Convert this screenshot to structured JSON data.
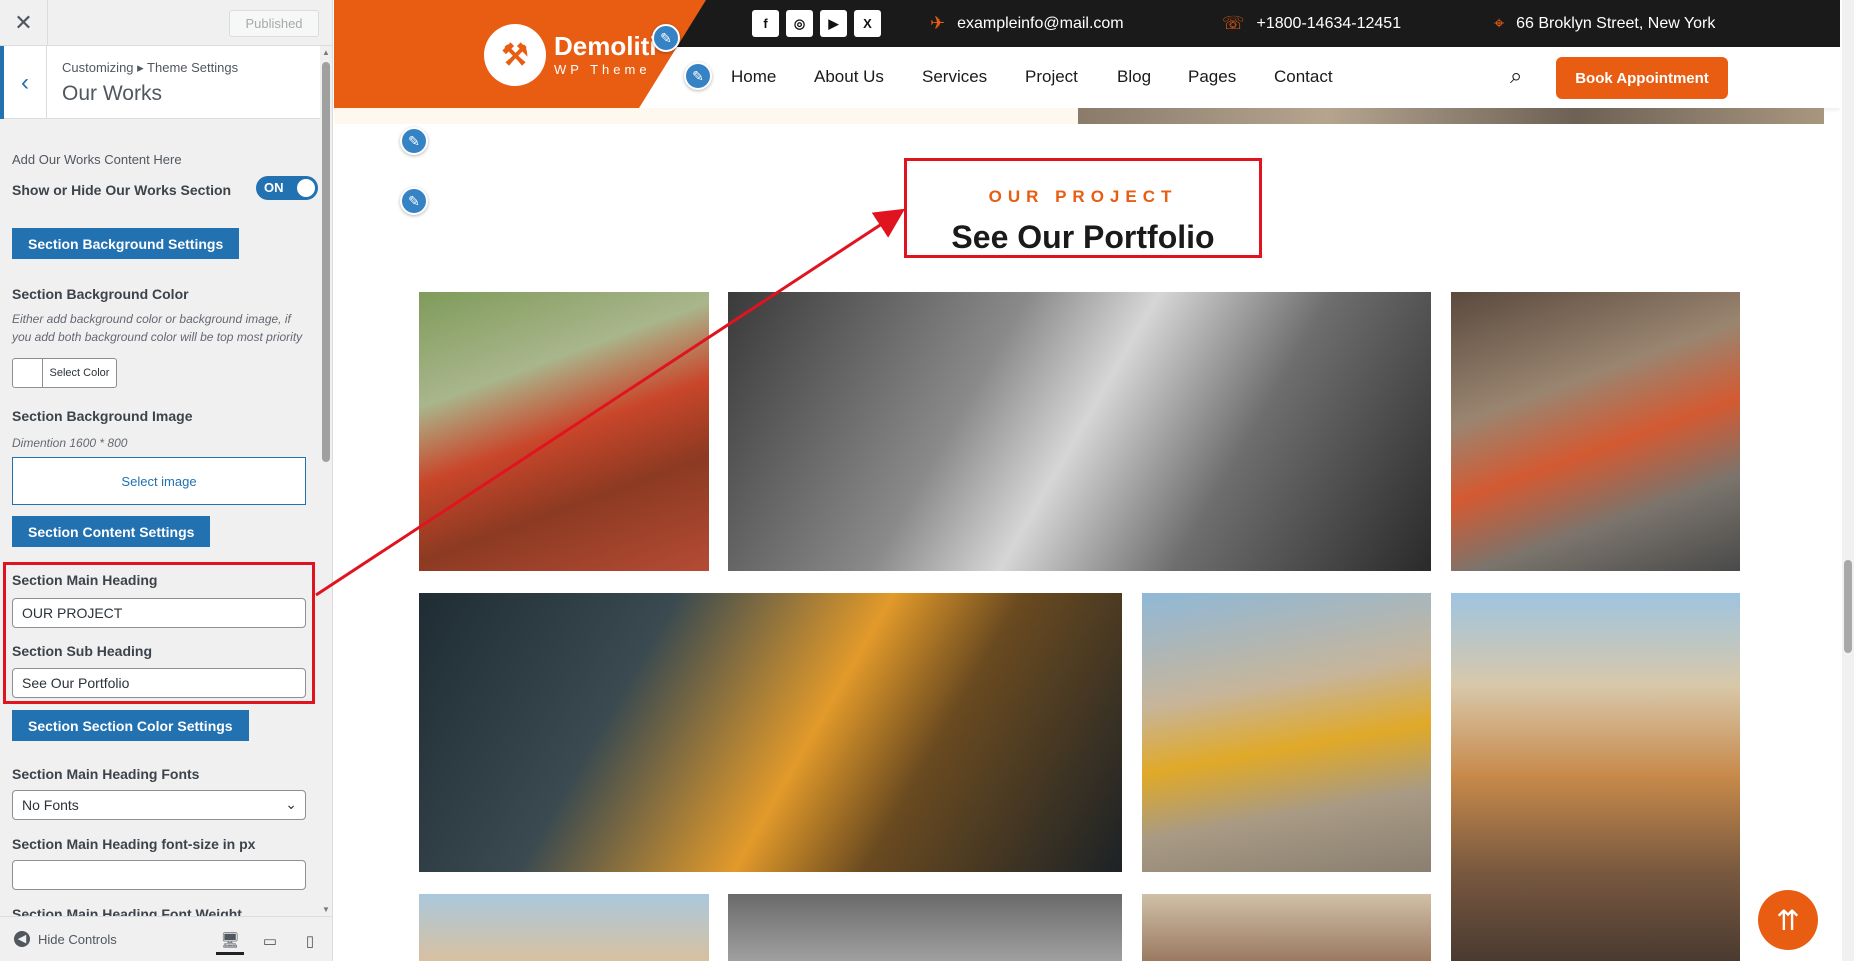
{
  "sidebar": {
    "published_label": "Published",
    "breadcrumb": "Customizing ▸ Theme Settings",
    "panel_title": "Our Works",
    "intro": "Add Our Works Content Here",
    "show_hide_label": "Show or Hide Our Works Section",
    "toggle_value": "ON",
    "bg_settings_button": "Section Background Settings",
    "bg_color_label": "Section Background Color",
    "bg_color_desc": "Either add background color or background image, if you add both background color will be top most priority",
    "select_color_button": "Select Color",
    "bg_image_label": "Section Background Image",
    "bg_image_desc": "Dimention 1600 * 800",
    "select_image_button": "Select image",
    "content_settings_button": "Section Content Settings",
    "main_heading_label": "Section Main Heading",
    "main_heading_value": "OUR PROJECT",
    "sub_heading_label": "Section Sub Heading",
    "sub_heading_value": "See Our Portfolio",
    "color_settings_button": "Section Section Color Settings",
    "heading_fonts_label": "Section Main Heading Fonts",
    "heading_fonts_value": "No Fonts",
    "heading_fontsize_label": "Section Main Heading font-size in px",
    "heading_fontsize_value": "",
    "heading_weight_label": "Section Main Heading Font Weight",
    "hide_controls_label": "Hide Controls"
  },
  "site": {
    "logo_name": "Demoliti",
    "logo_tagline": "WP Theme",
    "email": "exampleinfo@mail.com",
    "phone": "+1800-14634-12451",
    "address": "66 Broklyn Street, New York",
    "social": [
      "f",
      "◎",
      "▶",
      "X"
    ],
    "nav": [
      "Home",
      "About Us",
      "Services",
      "Project",
      "Blog",
      "Pages",
      "Contact"
    ],
    "book_button": "Book Appointment"
  },
  "section": {
    "heading": "OUR PROJECT",
    "subheading": "See Our Portfolio"
  },
  "icons": {
    "close": "close-icon",
    "back": "chevron-left-icon",
    "search": "search-icon",
    "edit": "pencil-icon",
    "scroll_top": "double-chevron-up-icon"
  },
  "colors": {
    "brand_orange": "#e85d12",
    "wp_blue": "#2271b1",
    "annotation_red": "#e0141f",
    "topbar_dark": "#1a1a1a"
  }
}
